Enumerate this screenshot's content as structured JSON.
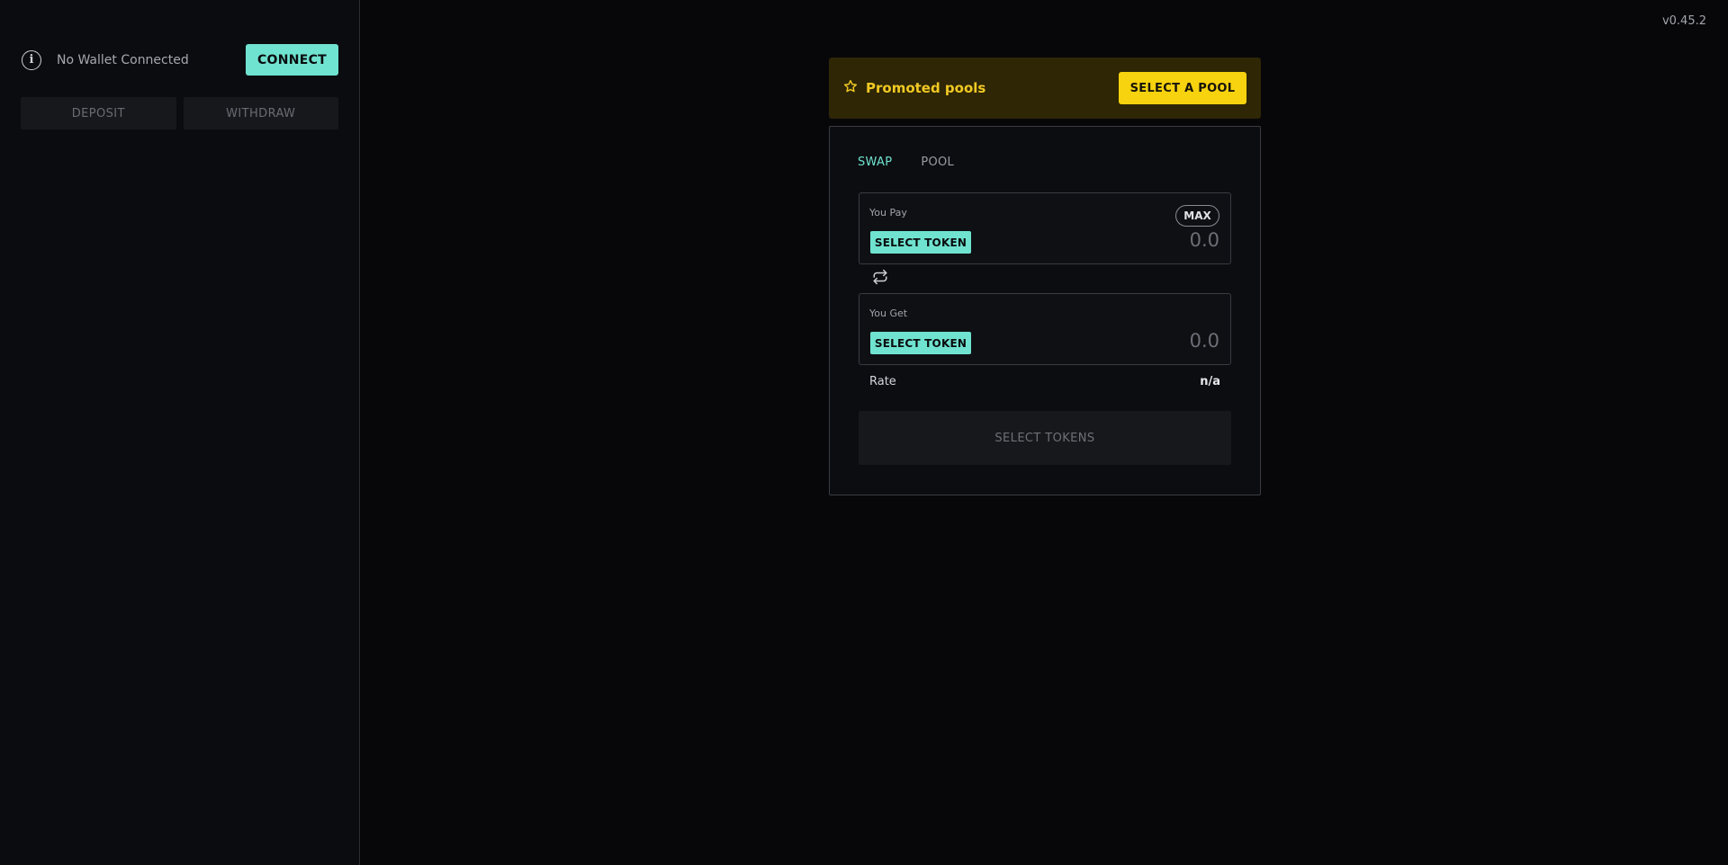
{
  "sidebar": {
    "wallet_status": "No Wallet Connected",
    "connect_label": "CONNECT",
    "deposit_label": "DEPOSIT",
    "withdraw_label": "WITHDRAW",
    "info_icon": "info-icon"
  },
  "header": {
    "version": "v0.45.2"
  },
  "promo": {
    "icon": "star-icon",
    "title": "Promoted pools",
    "select_pool_label": "SELECT A POOL"
  },
  "swap": {
    "tabs": [
      {
        "label": "SWAP",
        "active": true
      },
      {
        "label": "POOL",
        "active": false
      }
    ],
    "pay": {
      "label": "You Pay",
      "select_token_label": "SELECT TOKEN",
      "amount": "0.0",
      "max_label": "MAX"
    },
    "get": {
      "label": "You Get",
      "select_token_label": "SELECT TOKEN",
      "amount": "0.0"
    },
    "switch_icon": "swap-direction-icon",
    "rate_label": "Rate",
    "rate_value": "n/a",
    "submit_label": "SELECT TOKENS"
  },
  "colors": {
    "accent": "#6fe3cf",
    "promo_yellow": "#f7d20e",
    "background": "#07070a"
  }
}
